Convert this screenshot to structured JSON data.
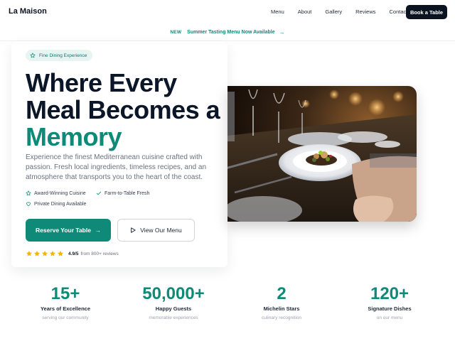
{
  "header": {
    "brand": "La Maison",
    "nav": [
      "Menu",
      "About",
      "Gallery",
      "Reviews",
      "Contact"
    ],
    "cta": "Book a Table"
  },
  "announcement": {
    "badge": "NEW",
    "message": "Summer Tasting Menu Now Available",
    "arrow": "→"
  },
  "hero": {
    "pill": "Fine Dining Experience",
    "headline_line1": "Where Every",
    "headline_line2": "Meal Becomes a",
    "headline_accent": "Memory",
    "description": "Experience the finest Mediterranean cuisine crafted with passion. Fresh local ingredients, timeless recipes, and an atmosphere that transports you to the heart of the coast.",
    "features": [
      "Award-Winning Cuisine",
      "Farm-to-Table Fresh",
      "Private Dining Available"
    ],
    "primary_button": "Reserve Your Table",
    "secondary_button": "View Our Menu",
    "rating": {
      "stars": 5,
      "score": "4.9/5",
      "reviews": "from 800+ reviews"
    }
  },
  "stats": [
    {
      "value": "15+",
      "label": "Years of Excellence",
      "sub": "serving our community"
    },
    {
      "value": "50,000+",
      "label": "Happy Guests",
      "sub": "memorable experiences"
    },
    {
      "value": "2",
      "label": "Michelin Stars",
      "sub": "culinary recognition"
    },
    {
      "value": "120+",
      "label": "Signature Dishes",
      "sub": "on our menu"
    }
  ],
  "colors": {
    "accent": "#0f8a78",
    "dark": "#0b1628",
    "star": "#f5b50a"
  }
}
